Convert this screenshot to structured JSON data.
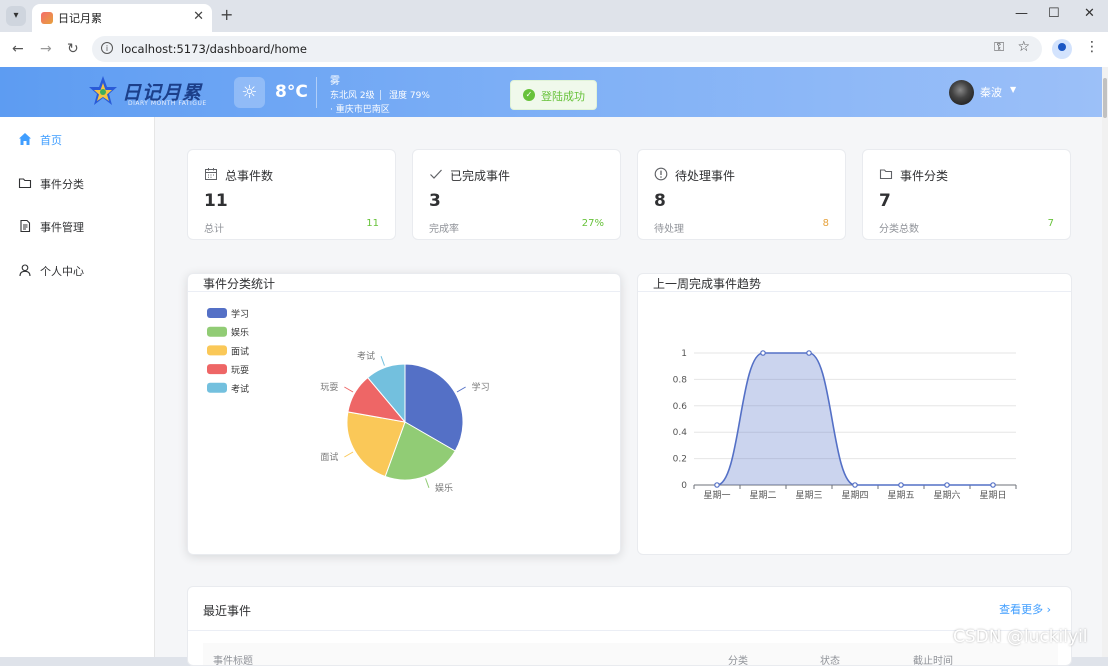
{
  "browser": {
    "tab_title": "日记月累",
    "url": "localhost:5173/dashboard/home"
  },
  "header": {
    "logo_text": "日记月累",
    "logo_subtitle": "DIARY MONTH FATIGUE",
    "weather": {
      "temperature": "8°C",
      "condition": "雾",
      "wind": "东北风 2级",
      "humidity": "湿度 79%",
      "location": "· 重庆市巴南区"
    },
    "toast": "登陆成功",
    "username": "秦波"
  },
  "sidebar": {
    "items": [
      {
        "label": "首页",
        "icon": "home-icon",
        "active": true
      },
      {
        "label": "事件分类",
        "icon": "folder-icon",
        "active": false
      },
      {
        "label": "事件管理",
        "icon": "document-icon",
        "active": false
      },
      {
        "label": "个人中心",
        "icon": "user-icon",
        "active": false
      }
    ]
  },
  "stats": [
    {
      "title": "总事件数",
      "icon": "calendar-icon",
      "value": "11",
      "footer": "总计",
      "metric": "11",
      "metric_color": "#67c23a"
    },
    {
      "title": "已完成事件",
      "icon": "check-icon",
      "value": "3",
      "footer": "完成率",
      "metric": "27%",
      "metric_color": "#67c23a"
    },
    {
      "title": "待处理事件",
      "icon": "info-circle-icon",
      "value": "8",
      "footer": "待处理",
      "metric": "8",
      "metric_color": "#e6a23c"
    },
    {
      "title": "事件分类",
      "icon": "folder-icon",
      "value": "7",
      "footer": "分类总数",
      "metric": "7",
      "metric_color": "#67c23a"
    }
  ],
  "panels": {
    "pie_title": "事件分类统计",
    "line_title": "上一周完成事件趋势"
  },
  "chart_data": [
    {
      "type": "pie",
      "title": "事件分类统计",
      "categories": [
        "学习",
        "娱乐",
        "面试",
        "玩耍",
        "考试"
      ],
      "values": [
        3,
        2,
        2,
        1,
        1
      ],
      "colors": [
        "#5470c6",
        "#91cc75",
        "#fac858",
        "#ee6666",
        "#73c0de"
      ],
      "legend_position": "top-left"
    },
    {
      "type": "area",
      "title": "上一周完成事件趋势",
      "categories": [
        "星期一",
        "星期二",
        "星期三",
        "星期四",
        "星期五",
        "星期六",
        "星期日"
      ],
      "values": [
        0,
        1,
        1,
        0,
        0,
        0,
        0
      ],
      "ylim": [
        0,
        1
      ],
      "yticks": [
        "0",
        "0.2",
        "0.4",
        "0.6",
        "0.8",
        "1"
      ],
      "smooth": true,
      "grid": true,
      "color": "#5470c6"
    }
  ],
  "recent": {
    "title": "最近事件",
    "more_label": "查看更多",
    "columns": [
      "事件标题",
      "分类",
      "状态",
      "截止时间"
    ]
  },
  "watermark": "CSDN @luckilyil"
}
